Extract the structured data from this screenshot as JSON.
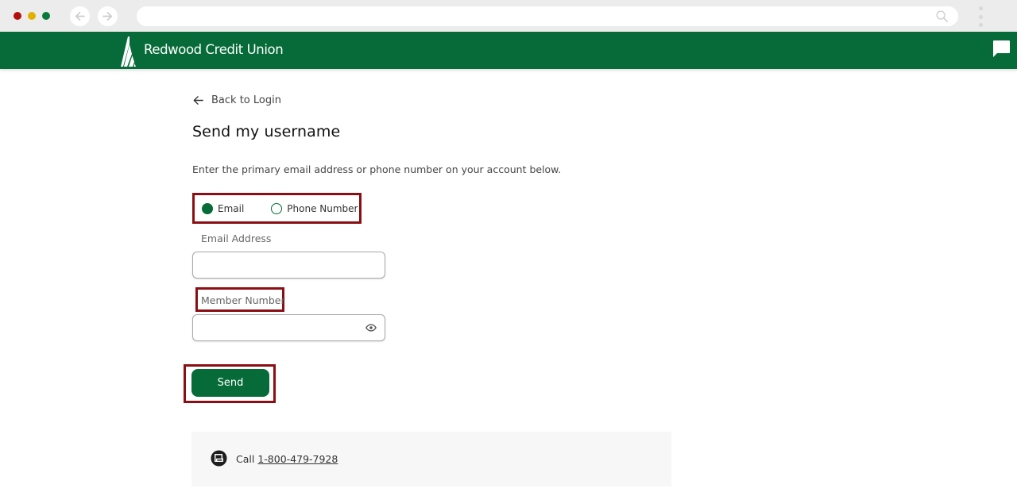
{
  "browser": {
    "back_icon": "arrow-left-icon",
    "forward_icon": "arrow-right-icon",
    "url": "",
    "search_icon": "magnifier-icon",
    "menu_icon": "vertical-dots-icon"
  },
  "header": {
    "brand": "Redwood Credit Union",
    "logo_icon": "redwood-tree-logo",
    "chat_icon": "chat-bubble-icon",
    "color": "#066b38"
  },
  "form": {
    "back_link": "Back to Login",
    "title": "Send my username",
    "instructions": "Enter the primary email address or phone number on your account below.",
    "contact_method": {
      "options": [
        "Email",
        "Phone Number"
      ],
      "selected": "Email"
    },
    "email_label": "Email Address",
    "email_value": "",
    "email_placeholder": "",
    "member_label": "Member Number",
    "member_value": "",
    "member_placeholder": "",
    "reveal_icon": "eye-icon",
    "send_label": "Send"
  },
  "help": {
    "call_prefix": "Call",
    "phone": "1-800-479-7928",
    "icon": "phone-chat-icon"
  },
  "highlight_color": "#8a0f14"
}
